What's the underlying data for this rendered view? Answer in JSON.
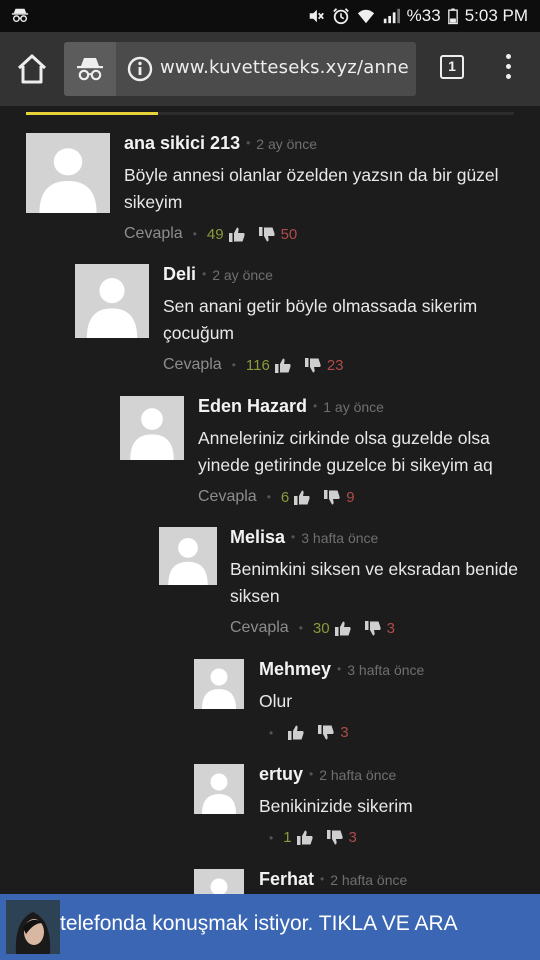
{
  "status_bar": {
    "battery": "%33",
    "time": "5:03 PM",
    "icons": [
      "incognito-icon",
      "mute-icon",
      "alarm-icon",
      "wifi-icon",
      "signal-icon",
      "battery-icon"
    ]
  },
  "browser": {
    "url": "www.kuvetteseks.xyz/annesi-sp",
    "tab_count": "1"
  },
  "comments": [
    {
      "author": "ana sikici 213",
      "time": "2 ay önce",
      "text": "Böyle annesi olanlar özelden yazsın da bir güzel sikeyim",
      "reply": "Cevapla",
      "up": "49",
      "down": "50"
    },
    {
      "author": "Deli",
      "time": "2 ay önce",
      "text": "Sen anani getir böyle olmassada sikerim çocuğum",
      "reply": "Cevapla",
      "up": "116",
      "down": "23"
    },
    {
      "author": "Eden Hazard",
      "time": "1 ay önce",
      "text": "Anneleriniz cirkinde olsa guzelde olsa yinede getirinde guzelce bi sikeyim aq",
      "reply": "Cevapla",
      "up": "6",
      "down": "9"
    },
    {
      "author": "Melisa",
      "time": "3 hafta önce",
      "text": "Benimkini siksen ve eksradan benide siksen",
      "reply": "Cevapla",
      "up": "30",
      "down": "3"
    },
    {
      "author": "Mehmey",
      "time": "3 hafta önce",
      "text": "Olur",
      "reply": "",
      "up": "",
      "down": "3"
    },
    {
      "author": "ertuy",
      "time": "2 hafta önce",
      "text": "Benikinizide sikerim",
      "reply": "",
      "up": "1",
      "down": "3"
    },
    {
      "author": "Ferhat",
      "time": "2 hafta önce",
      "text": "",
      "reply": "",
      "up": "",
      "down": ""
    }
  ],
  "banner": {
    "text": "telefonda konuşmak istiyor. TIKLA VE ARA"
  },
  "colors": {
    "background": "#1c1c1c",
    "toolbar": "#333333",
    "accent_underline": "#e8d23a",
    "upvote": "#8a9a3a",
    "downvote": "#b04b4b",
    "banner": "#3a66b3"
  }
}
